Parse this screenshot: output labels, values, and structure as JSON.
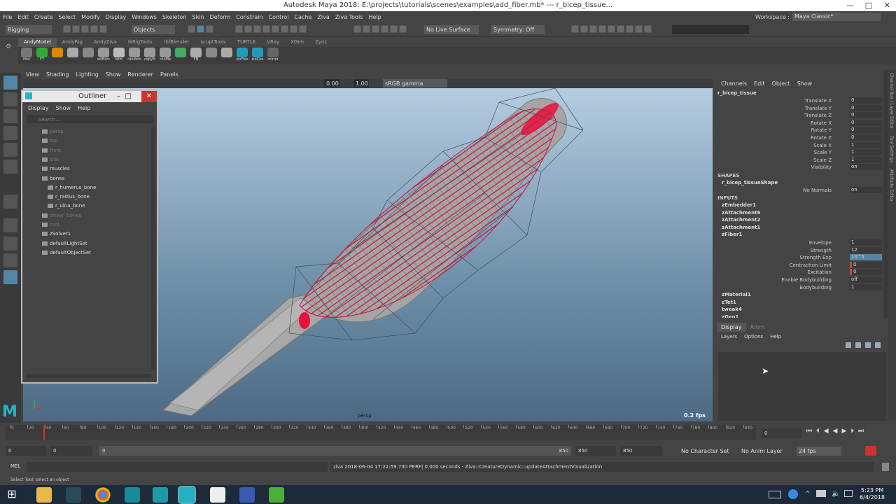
{
  "window": {
    "title": "Autodesk Maya 2018: E:\\projects\\tutorials\\scenes\\examples\\add_fiber.mb*   ---   r_bicep_tissue..."
  },
  "menubar": [
    "File",
    "Edit",
    "Create",
    "Select",
    "Modify",
    "Display",
    "Windows",
    "Skeleton",
    "Skin",
    "Deform",
    "Constrain",
    "Control",
    "Cache",
    "Ziva",
    "Ziva Tools",
    "Help"
  ],
  "workspace": {
    "label": "Workspace :",
    "value": "Maya Classic*"
  },
  "statusline": {
    "menuset": "Rigging",
    "selmode": "Objects",
    "live": "No Live Surface",
    "symmetry": "Symmetry: Off"
  },
  "shelf": {
    "tabs": [
      "AndyModel",
      "AndyRig",
      "AndyZiva",
      "IkRigTools",
      "rbfBlender",
      "scuptTools",
      "TURTLE",
      "VRay",
      "XGen",
      "Zync"
    ],
    "active_tab": "AndyModel",
    "buttons": [
      "Hist",
      "FT",
      "",
      "",
      "",
      "selBorc",
      "blim",
      "random",
      "copyM",
      "conMe",
      "",
      "FN",
      "",
      "",
      "isoFine",
      "isoCoa",
      "mirror"
    ]
  },
  "panel": {
    "menu": [
      "View",
      "Shading",
      "Lighting",
      "Show",
      "Renderer",
      "Panels"
    ],
    "exposure": "0.00",
    "gamma": "1.00",
    "colorspace": "sRGB gamma",
    "camera": "persp",
    "fps": "0.2 fps"
  },
  "outliner": {
    "title": "Outliner",
    "menu": [
      "Display",
      "Show",
      "Help"
    ],
    "search_placeholder": "Search...",
    "items": [
      {
        "label": "persp",
        "dim": true,
        "indent": 0
      },
      {
        "label": "top",
        "dim": true,
        "indent": 0
      },
      {
        "label": "front",
        "dim": true,
        "indent": 0
      },
      {
        "label": "side",
        "dim": true,
        "indent": 0
      },
      {
        "label": "muscles",
        "dim": false,
        "indent": 0
      },
      {
        "label": "bones",
        "dim": false,
        "indent": 0
      },
      {
        "label": "r_humerus_bone",
        "dim": false,
        "indent": 1
      },
      {
        "label": "r_radius_bone",
        "dim": false,
        "indent": 1
      },
      {
        "label": "r_ulna_bone",
        "dim": false,
        "indent": 1
      },
      {
        "label": "driver_bones",
        "dim": true,
        "indent": 0
      },
      {
        "label": "root",
        "dim": true,
        "indent": 0
      },
      {
        "label": "zSolver1",
        "dim": false,
        "indent": 0
      },
      {
        "label": "defaultLightSet",
        "dim": false,
        "indent": 0
      },
      {
        "label": "defaultObjectSet",
        "dim": false,
        "indent": 0
      }
    ]
  },
  "channelbox": {
    "menu": [
      "Channels",
      "Edit",
      "Object",
      "Show"
    ],
    "object": "r_bicep_tissue",
    "attrs": [
      {
        "label": "Translate X",
        "value": "0"
      },
      {
        "label": "Translate Y",
        "value": "0"
      },
      {
        "label": "Translate Z",
        "value": "0"
      },
      {
        "label": "Rotate X",
        "value": "0"
      },
      {
        "label": "Rotate Y",
        "value": "0"
      },
      {
        "label": "Rotate Z",
        "value": "0"
      },
      {
        "label": "Scale X",
        "value": "1"
      },
      {
        "label": "Scale Y",
        "value": "1"
      },
      {
        "label": "Scale Z",
        "value": "1"
      },
      {
        "label": "Visibility",
        "value": "on"
      }
    ],
    "shapes_header": "SHAPES",
    "shape": "r_bicep_tissueShape",
    "shape_attr": {
      "label": "No Normals",
      "value": "on"
    },
    "inputs_header": "INPUTS",
    "inputs": [
      "zEmbedder1",
      "zAttachment6",
      "zAttachment2",
      "zAttachment1",
      "zFiber1"
    ],
    "fiber_attrs": [
      {
        "label": "Envelope",
        "value": "1",
        "style": ""
      },
      {
        "label": "Strength",
        "value": "12",
        "style": ""
      },
      {
        "label": "Strength Exp",
        "value": "10^1",
        "style": "hl"
      },
      {
        "label": "Contraction Limit",
        "value": "0",
        "style": "red"
      },
      {
        "label": "Excitation",
        "value": "0",
        "style": "red"
      },
      {
        "label": "Enable Bodybuilding",
        "value": "off",
        "style": ""
      },
      {
        "label": "Bodybuilding",
        "value": "1",
        "style": ""
      }
    ],
    "more_inputs": [
      "zMaterial1",
      "zTet1",
      "tweak4",
      "zGeo1"
    ]
  },
  "layer": {
    "tabs": [
      "Display",
      "Anim"
    ],
    "menu": [
      "Layers",
      "Options",
      "Help"
    ]
  },
  "sidetabs": [
    "Channel Box / Layer Editor",
    "Tool Settings",
    "Attribute Editor"
  ],
  "timeline": {
    "ticks": [
      "0",
      "20",
      "40",
      "60",
      "80",
      "100",
      "120",
      "140",
      "160",
      "180",
      "200",
      "220",
      "240",
      "260",
      "280",
      "300",
      "320",
      "340",
      "360",
      "380",
      "400",
      "420",
      "440",
      "460",
      "480",
      "500",
      "520",
      "540",
      "560",
      "580",
      "600",
      "620",
      "640",
      "660",
      "680",
      "700",
      "720",
      "740",
      "760",
      "780",
      "800",
      "820",
      "840"
    ],
    "current": "0"
  },
  "range": {
    "start": "0",
    "min": "0",
    "slider_start": "0",
    "slider_end": "850",
    "end": "850",
    "max": "850",
    "character": "No Character Set",
    "anim_layer": "No Anim Layer",
    "fps": "24 fps"
  },
  "cmdline": {
    "mode": "MEL",
    "result": "ziva 2018-06-04 17:22:59.730 PERF|  0.000 seconds - Ziva::CreatureDynamic::updateAttachmentVisualization"
  },
  "helpline": "Select Tool: select an object",
  "clock": {
    "time": "5:23 PM",
    "date": "6/4/2018"
  },
  "colors": {
    "accent": "#5285a6",
    "fiber": "#e0103a"
  }
}
